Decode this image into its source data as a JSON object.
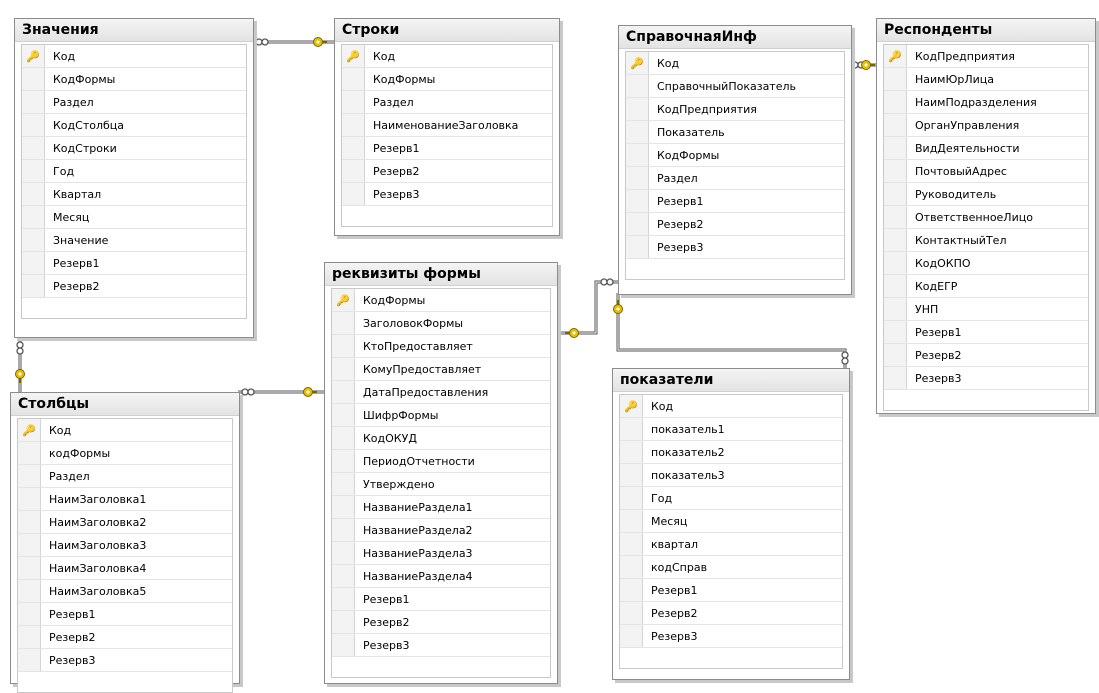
{
  "diagram": {
    "tables": [
      {
        "id": "znacheniya",
        "title": "Значения",
        "columns": [
          "Код",
          "КодФормы",
          "Раздел",
          "КодСтолбца",
          "КодСтроки",
          "Год",
          "Квартал",
          "Месяц",
          "Значение",
          "Резерв1",
          "Резерв2"
        ],
        "keys": [
          "Код"
        ]
      },
      {
        "id": "stroki",
        "title": "Строки",
        "columns": [
          "Код",
          "КодФормы",
          "Раздел",
          "НаименованиеЗаголовка",
          "Резерв1",
          "Резерв2",
          "Резерв3"
        ],
        "keys": [
          "Код"
        ]
      },
      {
        "id": "spravochnaya",
        "title": "СправочнаяИнф",
        "columns": [
          "Код",
          "СправочныйПоказатель",
          "КодПредприятия",
          "Показатель",
          "КодФормы",
          "Раздел",
          "Резерв1",
          "Резерв2",
          "Резерв3"
        ],
        "keys": [
          "Код"
        ]
      },
      {
        "id": "respondenty",
        "title": "Респонденты",
        "columns": [
          "КодПредприятия",
          "НаимЮрЛица",
          "НаимПодразделения",
          "ОрганУправления",
          "ВидДеятельности",
          "ПочтовыйАдрес",
          "Руководитель",
          "ОтветственноеЛицо",
          "КонтактныйТел",
          "КодОКПО",
          "КодЕГР",
          "УНП",
          "Резерв1",
          "Резерв2",
          "Резерв3"
        ],
        "keys": [
          "КодПредприятия"
        ]
      },
      {
        "id": "stolbcy",
        "title": "Столбцы",
        "columns": [
          "Код",
          "кодФормы",
          "Раздел",
          "НаимЗаголовка1",
          "НаимЗаголовка2",
          "НаимЗаголовка3",
          "НаимЗаголовка4",
          "НаимЗаголовка5",
          "Резерв1",
          "Резерв2",
          "Резерв3"
        ],
        "keys": [
          "Код"
        ]
      },
      {
        "id": "rekvizity",
        "title": "реквизиты формы",
        "columns": [
          "КодФормы",
          "ЗаголовокФормы",
          "КтоПредоставляет",
          "КомуПредоставляет",
          "ДатаПредоставления",
          "ШифрФормы",
          "КодОКУД",
          "ПериодОтчетности",
          "Утверждено",
          "НазваниеРаздела1",
          "НазваниеРаздела2",
          "НазваниеРаздела3",
          "НазваниеРаздела4",
          "Резерв1",
          "Резерв2",
          "Резерв3"
        ],
        "keys": [
          "КодФормы"
        ]
      },
      {
        "id": "pokazateli",
        "title": "показатели",
        "columns": [
          "Код",
          "показатель1",
          "показатель2",
          "показатель3",
          "Год",
          "Месяц",
          "квартал",
          "кодСправ",
          "Резерв1",
          "Резерв2",
          "Резерв3"
        ],
        "keys": [
          "Код"
        ]
      }
    ],
    "relationships": [
      {
        "name": "Значения-Строки"
      },
      {
        "name": "Значения-Столбцы"
      },
      {
        "name": "Столбцы-реквизиты формы"
      },
      {
        "name": "реквизиты формы-СправочнаяИнф"
      },
      {
        "name": "СправочнаяИнф-Респонденты"
      },
      {
        "name": "СправочнаяИнф-показатели"
      }
    ],
    "colors": {
      "key": "#e8c100",
      "line": "#555555",
      "border": "#8c8c8c"
    }
  }
}
